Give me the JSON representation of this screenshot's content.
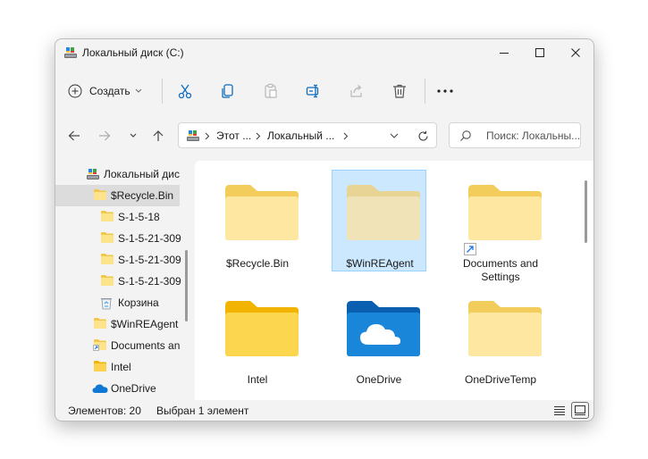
{
  "window": {
    "title": "Локальный диск (C:)"
  },
  "toolbar": {
    "create_label": "Создать",
    "buttons": [
      "cut-icon",
      "copy-icon",
      "paste-icon",
      "rename-icon",
      "share-icon",
      "delete-icon",
      "more-icon"
    ]
  },
  "address": {
    "segments": [
      "Этот ...",
      "Локальный ..."
    ]
  },
  "search": {
    "placeholder": "Поиск: Локальны..."
  },
  "sidebar": {
    "items": [
      {
        "label": "Локальный дис",
        "icon": "drive-icon"
      },
      {
        "label": "$Recycle.Bin",
        "icon": "folder-icon",
        "selected": true
      },
      {
        "label": "S-1-5-18",
        "icon": "folder-icon"
      },
      {
        "label": "S-1-5-21-309",
        "icon": "folder-icon"
      },
      {
        "label": "S-1-5-21-309",
        "icon": "folder-icon"
      },
      {
        "label": "S-1-5-21-309",
        "icon": "folder-icon"
      },
      {
        "label": "Корзина",
        "icon": "recycle-bin-icon"
      },
      {
        "label": "$WinREAgent",
        "icon": "folder-icon"
      },
      {
        "label": "Documents an",
        "icon": "folder-shortcut-icon"
      },
      {
        "label": "Intel",
        "icon": "folder-icon"
      },
      {
        "label": "OneDrive",
        "icon": "onedrive-icon"
      }
    ]
  },
  "content": {
    "items": [
      {
        "label": "$Recycle.Bin",
        "icon": "folder-icon"
      },
      {
        "label": "$WinREAgent",
        "icon": "folder-icon",
        "selected": true
      },
      {
        "label": "Documents and Settings",
        "icon": "folder-shortcut-icon"
      },
      {
        "label": "Intel",
        "icon": "folder-icon"
      },
      {
        "label": "OneDrive",
        "icon": "onedrive-folder-icon"
      },
      {
        "label": "OneDriveTemp",
        "icon": "folder-icon"
      }
    ]
  },
  "status": {
    "count": "Элементов: 20",
    "selection": "Выбран 1 элемент"
  },
  "colors": {
    "selection_bg": "#cce8ff",
    "selection_border": "#99d1ff",
    "folder_yellow": "#fde38a",
    "onedrive_blue": "#0f78d4"
  }
}
